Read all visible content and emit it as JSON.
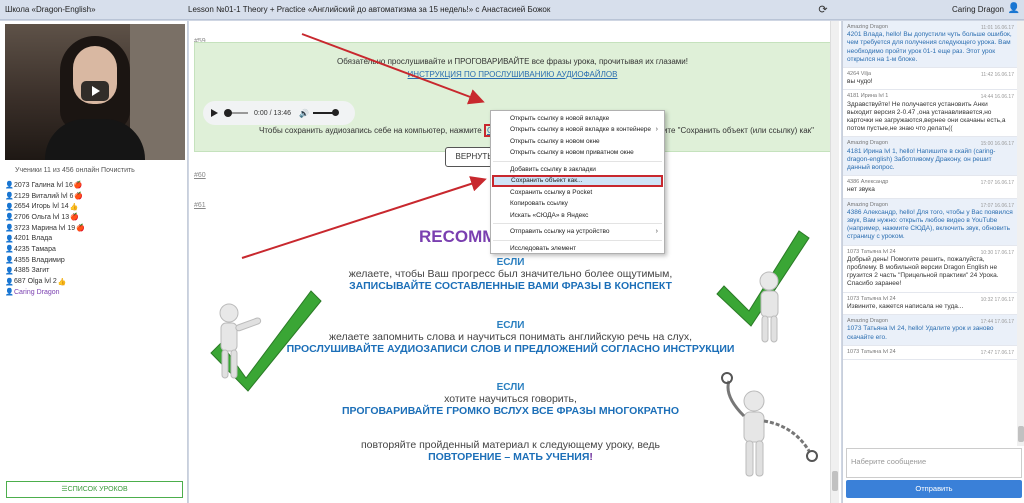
{
  "topbar": {
    "school": "Школа «Dragon-English»",
    "lesson": "Lesson №01-1 Theory + Practice «Английский до автоматизма за 15 недель!» с Анастасией Божок",
    "user": "Caring Dragon"
  },
  "left": {
    "online_text": "Ученики 11 из 456 онлайн Почистить",
    "users": [
      {
        "label": "2073 Галина lvl 16",
        "badge": "apple"
      },
      {
        "label": "2129 Виталий lvl 6",
        "badge": "apple"
      },
      {
        "label": "2654 Игорь lvl 14",
        "badge": "hand"
      },
      {
        "label": "2706 Ольга lvl 13",
        "badge": "apple"
      },
      {
        "label": "3723 Марина lvl 19",
        "badge": "apple"
      },
      {
        "label": "4201 Влада",
        "badge": ""
      },
      {
        "label": "4235 Тамара",
        "badge": ""
      },
      {
        "label": "4355 Владимир",
        "badge": ""
      },
      {
        "label": "4385 Загит",
        "badge": ""
      },
      {
        "label": "687 Olga lvl 2",
        "badge": "hand"
      },
      {
        "label": "Caring Dragon",
        "badge": "",
        "me": true
      }
    ],
    "list_button": "☰СПИСОК УРОКОВ"
  },
  "center": {
    "num59": "#59",
    "num60": "#60",
    "num61": "#61",
    "green_text1": "Обязательно прослушивайте и ПРОГОВАРИВАЙТЕ все фразы урока, прочитывая их глазами!",
    "green_link": "ИНСТРУКЦИЯ ПО ПРОСЛУШИВАНИЮ АУДИОФАЙЛОВ",
    "audio_time": "0:00 / 13:46",
    "save_text_a": "Чтобы сохранить аудиозапись себе на компьютер, нажмите",
    "save_link": "СЮДА",
    "save_text_b": "правой кнопкой мышки и выберите \"Сохранить объект (или ссылку) как\"",
    "return_button": "ВЕРНУТЬ",
    "recommend": "RECOMM",
    "blocks": [
      {
        "if": "ЕСЛИ",
        "line1": "желаете, чтобы Ваш прогресс был значительно более ощутимым,",
        "line2": "ЗАПИСЫВАЙТЕ СОСТАВЛЕННЫЕ ВАМИ ФРАЗЫ В КОНСПЕКТ"
      },
      {
        "if": "ЕСЛИ",
        "line1": "желаете запомнить слова и научиться понимать английскую речь на слух,",
        "line2": "ПРОСЛУШИВАЙТЕ АУДИОЗАПИСИ СЛОВ И ПРЕДЛОЖЕНИЙ СОГЛАСНО ИНСТРУКЦИИ"
      },
      {
        "if": "ЕСЛИ",
        "line1": "хотите научиться говорить,",
        "line2": "ПРОГОВАРИВАЙТЕ ГРОМКО ВСЛУХ ВСЕ ФРАЗЫ МНОГОКРАТНО"
      }
    ],
    "final_line1": "повторяйте пройденный материал к следующему уроку, ведь",
    "final_line2": "ПОВТОРЕНИЕ – МАТЬ УЧЕНИЯ",
    "final_excl": "!"
  },
  "context_menu": {
    "items": [
      {
        "label": "Открыть ссылку в новой вкладке",
        "arrow": ""
      },
      {
        "label": "Открыть ссылку в новой вкладке в контейнере",
        "arrow": "›"
      },
      {
        "label": "Открыть ссылку в новом окне",
        "arrow": ""
      },
      {
        "label": "Открыть ссылку в новом приватном окне",
        "arrow": ""
      },
      {
        "sep": true
      },
      {
        "label": "Добавить ссылку в закладки",
        "arrow": ""
      },
      {
        "label": "Сохранить объект как...",
        "arrow": "",
        "selected": true
      },
      {
        "label": "Сохранить ссылку в Pocket",
        "arrow": ""
      },
      {
        "label": "Копировать ссылку",
        "arrow": ""
      },
      {
        "label": "Искать «СЮДА» в Яндекс",
        "arrow": ""
      },
      {
        "sep": true
      },
      {
        "label": "Отправить ссылку на устройство",
        "arrow": "›"
      },
      {
        "sep": true
      },
      {
        "label": "Исследовать элемент",
        "arrow": ""
      }
    ]
  },
  "chat": {
    "messages": [
      {
        "author": "Amazing Dragon",
        "time": "11:01 16.06.17",
        "text": "4201 Влада, hello! Вы допустили чуть больше ошибок, чем требуется для получения следующего урока. Вам необходимо пройти урок 01-1 еще раз. Этот урок открылся на 1-м блоке.",
        "amazing": true
      },
      {
        "author": "4264 Vilja",
        "time": "11:42 16.06.17",
        "text": "вы чудо!",
        "amazing": false
      },
      {
        "author": "4181 Ирина lvl 1",
        "time": "14:44 16.06.17",
        "text": "Здравствуйте! Не получается установить Анки выходит версия 2-0.47 ,она устанавливается,но карточки не загружаются,вернее они скачаны есть,а потом пустые,не знаю что делать((",
        "amazing": false
      },
      {
        "author": "Amazing Dragon",
        "time": "15:00 16.06.17",
        "text": "4181 Ирина lvl 1, hello! Напишите в скайп (caring-dragon-english) Заботливому Дракону, он решит данный вопрос.",
        "amazing": true
      },
      {
        "author": "4386 Александр",
        "time": "17:07 16.06.17",
        "text": "нет звука",
        "amazing": false
      },
      {
        "author": "Amazing Dragon",
        "time": "17:07 16.06.17",
        "text": "4386 Александр, hello! Для того, чтобы у Вас появился звук, Вам нужно: открыть любое видео в YouTube (например, нажмите СЮДА), включить звук, обновить страницу с уроком.",
        "amazing": true
      },
      {
        "author": "1073 Татьяна lvl 24",
        "time": "10:30 17.06.17",
        "text": "Добрый день! Помогите решить, пожалуйста, проблему. В мобильной версии Dragon English не грузится 2 часть \"Прицельной практики\" 24 Урока. Спасибо заранее!",
        "amazing": false
      },
      {
        "author": "1073 Татьяна lvl 24",
        "time": "10:32 17.06.17",
        "text": "Извините, кажется написала не туда...",
        "amazing": false
      },
      {
        "author": "Amazing Dragon",
        "time": "17:44 17.06.17",
        "text": "1073 Татьяна lvl 24, hello! Удалите урок и заново скачайте его.",
        "amazing": true
      },
      {
        "author": "1073 Татьяна lvl 24",
        "time": "17:47 17.06.17",
        "text": "",
        "amazing": false
      }
    ],
    "input_placeholder": "Наберите сообщение",
    "send_label": "Отправить"
  },
  "colors": {
    "accent": "#3a80d8",
    "green_box": "#dff0d8",
    "highlight_red": "#c8282e",
    "heading_blue": "#1c6fb8",
    "recommend_purple": "#7a3fb0"
  }
}
